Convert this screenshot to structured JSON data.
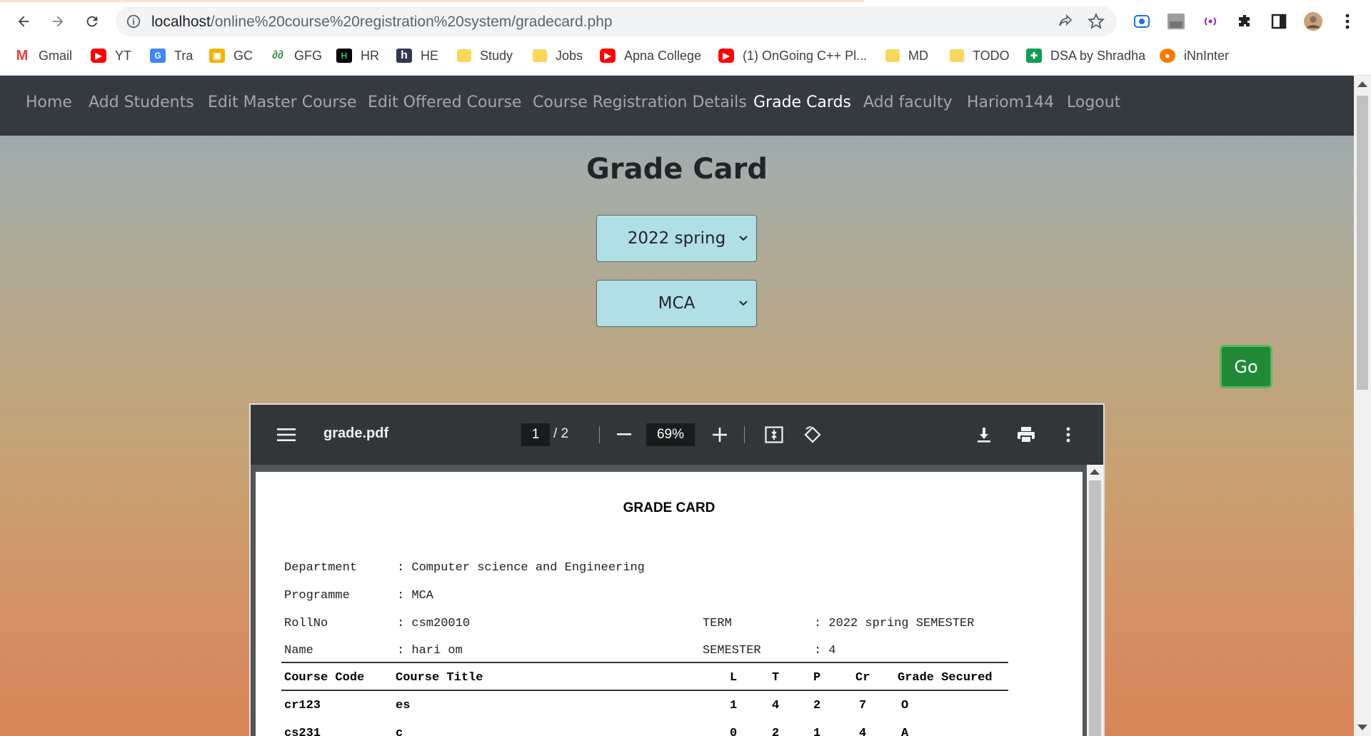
{
  "browser": {
    "url_host": "localhost",
    "url_path": "/online%20course%20registration%20system/gradecard.php",
    "bookmarks": [
      {
        "label": "Gmail",
        "icon": "gmail-icon",
        "color": "#ea4335"
      },
      {
        "label": "YT",
        "icon": "youtube-icon",
        "color": "#ff0000"
      },
      {
        "label": "Tra",
        "icon": "translate-icon",
        "color": "#4285f4"
      },
      {
        "label": "GC",
        "icon": "classroom-icon",
        "color": "#f4b400"
      },
      {
        "label": "GFG",
        "icon": "gfg-icon",
        "color": "#2f8d46"
      },
      {
        "label": "HR",
        "icon": "hackerrank-icon",
        "color": "#000000"
      },
      {
        "label": "HE",
        "icon": "hackerearth-icon",
        "color": "#323754"
      },
      {
        "label": "Study",
        "icon": "folder-icon",
        "color": "#f9d65c"
      },
      {
        "label": "Jobs",
        "icon": "folder-icon",
        "color": "#f9d65c"
      },
      {
        "label": "Apna College",
        "icon": "youtube-icon",
        "color": "#ff0000"
      },
      {
        "label": "(1) OnGoing C++ Pl...",
        "icon": "youtube-icon",
        "color": "#ff0000"
      },
      {
        "label": "MD",
        "icon": "folder-icon",
        "color": "#f9d65c"
      },
      {
        "label": "TODO",
        "icon": "folder-icon",
        "color": "#f9d65c"
      },
      {
        "label": "DSA by Shradha",
        "icon": "sheets-icon",
        "color": "#0f9d58"
      },
      {
        "label": "iNnInter",
        "icon": "globe-icon",
        "color": "#f57c00"
      }
    ]
  },
  "nav": {
    "items": [
      "Home",
      "Add Students",
      "Edit Master Course",
      "Edit Offered Course",
      "Course Registration Details",
      "Grade Cards",
      "Add faculty",
      "Hariom144",
      "Logout"
    ],
    "active": "Grade Cards"
  },
  "main": {
    "title": "Grade Card",
    "term_select": "2022 spring",
    "program_select": "MCA",
    "go_label": "Go"
  },
  "pdf": {
    "filename": "grade.pdf",
    "page_current": "1",
    "page_total": "/  2",
    "zoom": "69%",
    "doc": {
      "title": "GRADE CARD",
      "department_label": "Department",
      "department_value": ": Computer science and Engineering",
      "programme_label": "Programme",
      "programme_value": ": MCA",
      "rollno_label": "RollNo",
      "rollno_value": ": csm20010",
      "term_label": "TERM",
      "term_value": ": 2022 spring SEMESTER",
      "name_label": "Name",
      "name_value": ": hari om",
      "semester_label": "SEMESTER",
      "semester_value": ": 4",
      "columns": [
        "Course Code",
        "Course Title",
        "L",
        "T",
        "P",
        "Cr",
        "Grade Secured"
      ],
      "rows": [
        [
          "cr123",
          "es",
          "1",
          "4",
          "2",
          "7",
          "O"
        ],
        [
          "cs231",
          "c",
          "0",
          "2",
          "1",
          "4",
          "A"
        ]
      ]
    }
  }
}
